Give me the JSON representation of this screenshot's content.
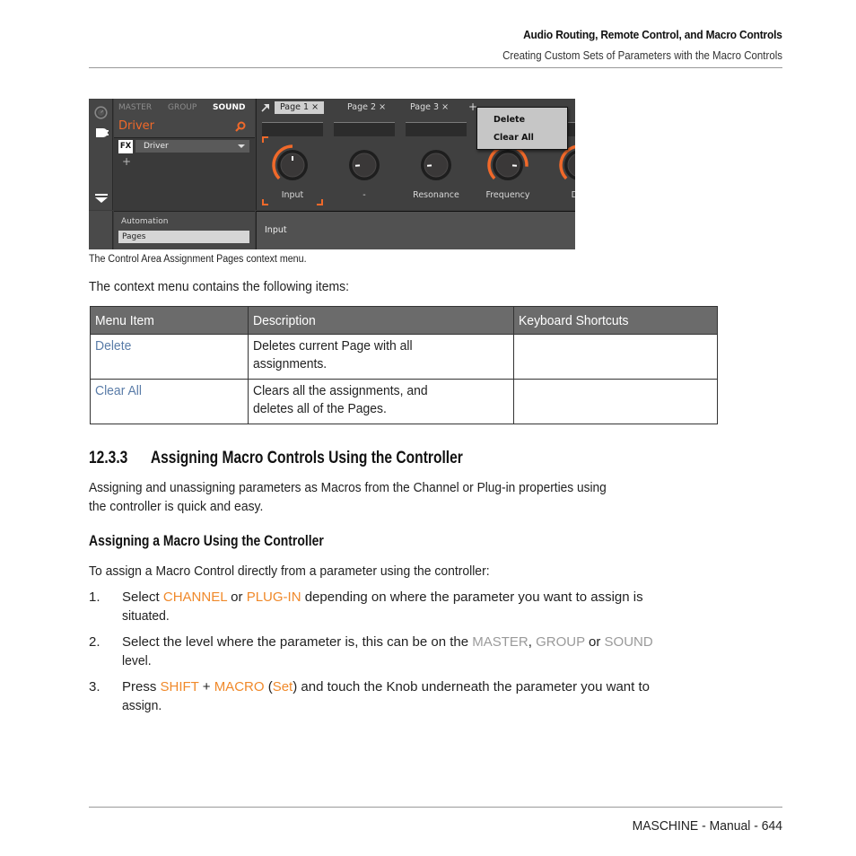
{
  "header": {
    "chapter_title": "Audio Routing, Remote Control, and Macro Controls",
    "section_title": "Creating Custom Sets of Parameters with the Macro Controls"
  },
  "screenshot": {
    "levels": [
      "MASTER",
      "GROUP",
      "SOUND"
    ],
    "active_level": "SOUND",
    "browser_title": "Driver",
    "fx_badge": "FX",
    "fx_slot": "Driver",
    "add_symbol": "+",
    "bottom_labels": {
      "automation": "Automation",
      "pages": "Pages"
    },
    "tabs": [
      {
        "label": "Page 1 ×",
        "active": true
      },
      {
        "label": "Page 2 ×",
        "active": false
      },
      {
        "label": "Page 3 ×",
        "active": false
      }
    ],
    "tab_add": "+",
    "knobs": [
      {
        "label": "Input",
        "value": 0.5,
        "arc": true,
        "selected": true
      },
      {
        "label": "-",
        "value": 0.15,
        "arc": false,
        "selected": false
      },
      {
        "label": "Resonance",
        "value": 0.15,
        "arc": false,
        "selected": false
      },
      {
        "label": "Frequency",
        "value": 0.85,
        "arc": true,
        "selected": false
      },
      {
        "label": "Dist",
        "value": 0.5,
        "arc": true,
        "selected": false
      }
    ],
    "selected_param": "Input",
    "context_menu": [
      "Delete",
      "Clear All"
    ],
    "accent_color": "#f0692a"
  },
  "caption": "The Control Area Assignment Pages context menu.",
  "intro": "The context menu contains the following items:",
  "table": {
    "headers": [
      "Menu Item",
      "Description",
      "Keyboard Shortcuts"
    ],
    "rows": [
      {
        "item": "Delete",
        "desc_lines": [
          "Deletes current Page with all",
          "assignments."
        ],
        "shortcut": ""
      },
      {
        "item": "Clear All",
        "desc_lines": [
          "Clears all the assignments, and",
          "deletes all of the Pages."
        ],
        "shortcut": ""
      }
    ]
  },
  "section": {
    "number": "12.3.3",
    "title": "Assigning Macro Controls Using the Controller",
    "para_lines": [
      "Assigning and unassigning parameters as Macros from the Channel or Plug-in properties using",
      "the controller is quick and easy."
    ],
    "subheading": "Assigning a Macro Using the Controller",
    "lead": "To assign a Macro Control directly from a parameter using the controller:",
    "steps": [
      {
        "n": "1.",
        "parts": [
          [
            "Select ",
            ""
          ],
          [
            "CHANNEL",
            "orange"
          ],
          [
            " or ",
            ""
          ],
          [
            "PLUG-IN",
            "orange"
          ],
          [
            " depending on where the parameter you want to assign is",
            ""
          ]
        ],
        "line2": "situated."
      },
      {
        "n": "2.",
        "parts": [
          [
            "Select the level where the parameter is, this can be on the ",
            ""
          ],
          [
            "MASTER",
            "grey"
          ],
          [
            ", ",
            ""
          ],
          [
            "GROUP",
            "grey"
          ],
          [
            " or ",
            ""
          ],
          [
            "SOUND",
            "grey"
          ]
        ],
        "line2": "level."
      },
      {
        "n": "3.",
        "parts": [
          [
            "Press ",
            ""
          ],
          [
            "SHIFT",
            "orange"
          ],
          [
            " + ",
            ""
          ],
          [
            "MACRO",
            "orange"
          ],
          [
            " (",
            ""
          ],
          [
            "Set",
            "orange"
          ],
          [
            ") and touch the Knob underneath the parameter you want to",
            ""
          ]
        ],
        "line2": "assign."
      }
    ]
  },
  "footer": "MASCHINE - Manual - 644"
}
